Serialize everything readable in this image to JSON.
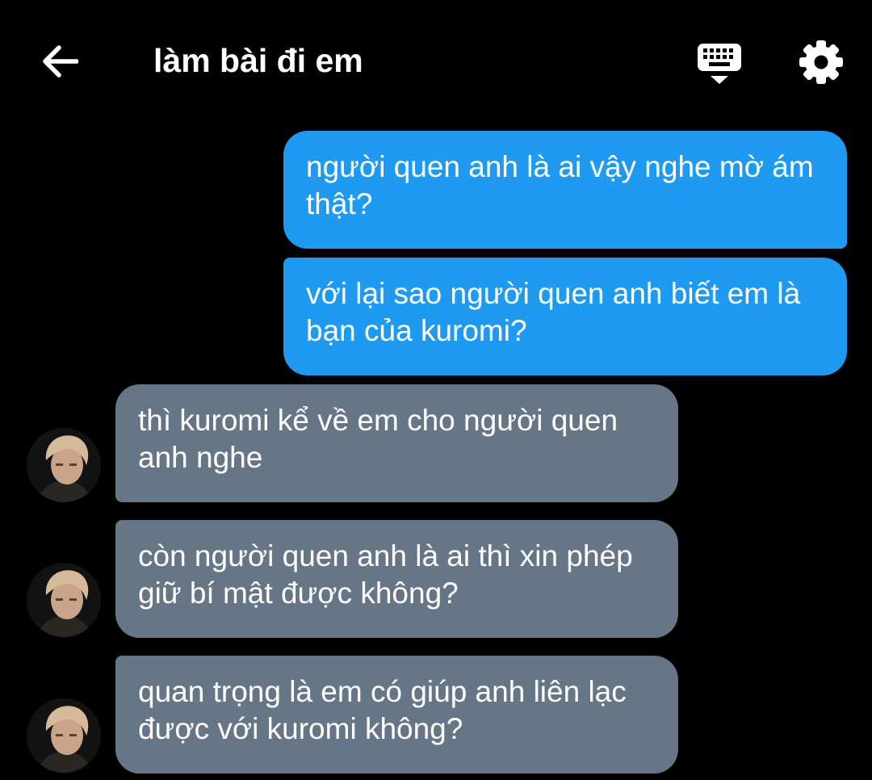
{
  "header": {
    "title": "làm bài đi em",
    "back_icon": "arrow-left-icon",
    "keyboard_icon": "keyboard-hide-icon",
    "settings_icon": "gear-icon"
  },
  "colors": {
    "background": "#000000",
    "outgoing_bubble": "#1e9bf0",
    "incoming_bubble": "#677686",
    "text": "#ffffff"
  },
  "messages": [
    {
      "direction": "outgoing",
      "text": "người quen anh là ai vậy nghe mờ ám thật?"
    },
    {
      "direction": "outgoing",
      "text": "với lại sao người quen anh biết em là bạn của kuromi?"
    },
    {
      "direction": "incoming",
      "text": "thì kuromi kể về em cho người quen anh nghe"
    },
    {
      "direction": "incoming",
      "text": "còn người quen anh là ai thì xin phép giữ bí mật được không?"
    },
    {
      "direction": "incoming",
      "text": "quan trọng là em có giúp anh liên lạc được với kuromi không?"
    }
  ]
}
